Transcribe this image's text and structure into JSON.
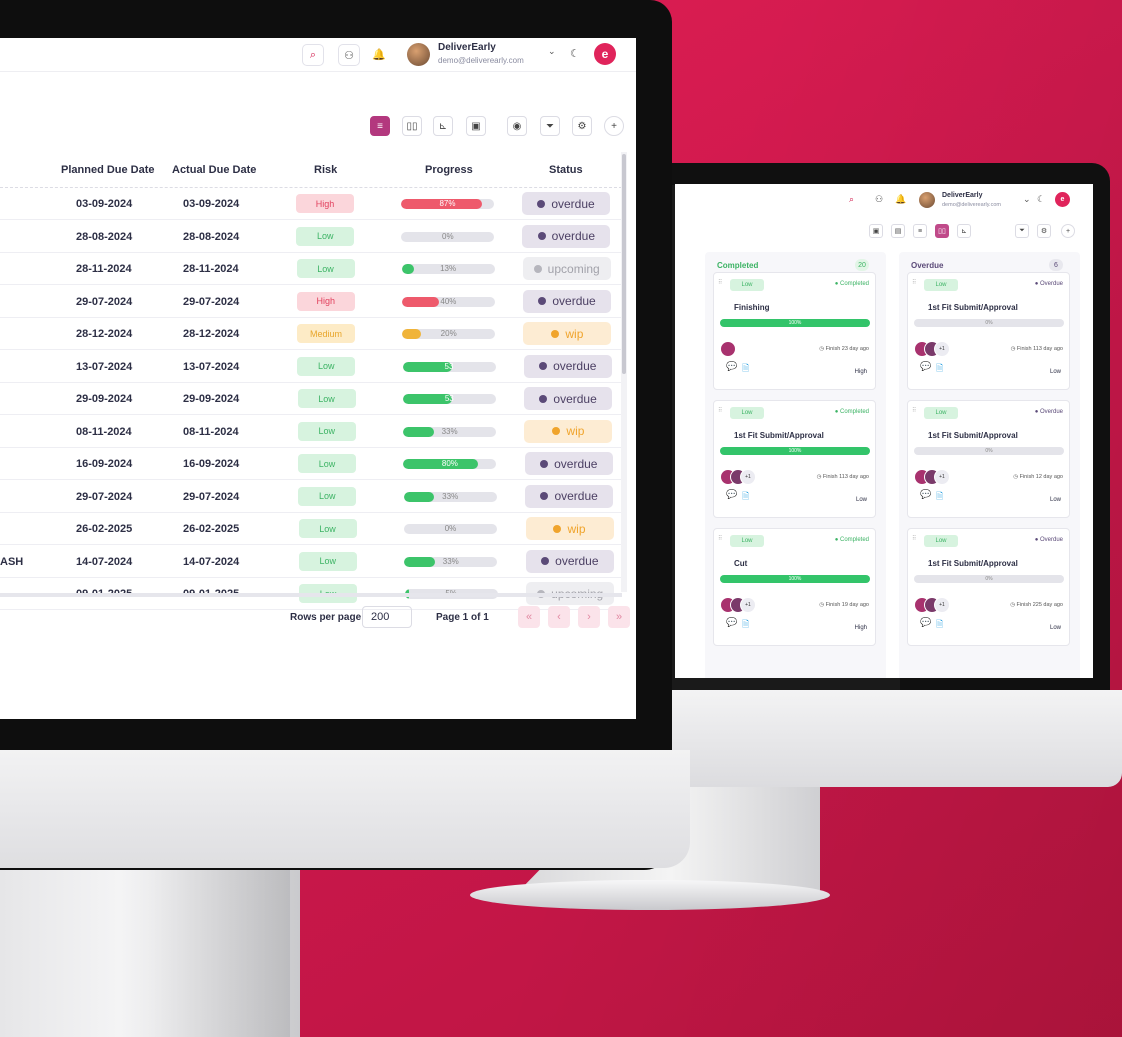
{
  "colors": {
    "brand": "#d11a4c",
    "accent": "#b3387e",
    "high": "#e2415e",
    "low": "#3cb364",
    "medium": "#e8a62c"
  },
  "header": {
    "user_name": "DeliverEarly",
    "user_email": "demo@deliverearly.com",
    "icons": [
      "search-icon",
      "user-add-icon",
      "bell-icon",
      "chevron-down-icon",
      "theme-icon",
      "logo"
    ]
  },
  "toolbar": {
    "icons": [
      "list-view-icon",
      "board-view-icon",
      "gantt-view-icon",
      "archive-icon",
      "eye-icon",
      "filter-icon",
      "settings-icon",
      "add-icon"
    ]
  },
  "table": {
    "columns": {
      "planned": "Planned Due Date",
      "actual": "Actual Due Date",
      "risk": "Risk",
      "progress": "Progress",
      "status": "Status"
    },
    "rows": [
      {
        "name": "",
        "planned": "03-09-2024",
        "actual": "03-09-2024",
        "risk": "High",
        "progress": 87,
        "progress_label": "87%",
        "status": "overdue"
      },
      {
        "name": "",
        "planned": "28-08-2024",
        "actual": "28-08-2024",
        "risk": "Low",
        "progress": 0,
        "progress_label": "0%",
        "status": "overdue"
      },
      {
        "name": "",
        "planned": "28-11-2024",
        "actual": "28-11-2024",
        "risk": "Low",
        "progress": 13,
        "progress_label": "13%",
        "status": "upcoming"
      },
      {
        "name": "",
        "planned": "29-07-2024",
        "actual": "29-07-2024",
        "risk": "High",
        "progress": 40,
        "progress_label": "40%",
        "status": "overdue"
      },
      {
        "name": "",
        "planned": "28-12-2024",
        "actual": "28-12-2024",
        "risk": "Medium",
        "progress": 20,
        "progress_label": "20%",
        "status": "wip"
      },
      {
        "name": "",
        "planned": "13-07-2024",
        "actual": "13-07-2024",
        "risk": "Low",
        "progress": 53,
        "progress_label": "53",
        "status": "overdue"
      },
      {
        "name": "",
        "planned": "29-09-2024",
        "actual": "29-09-2024",
        "risk": "Low",
        "progress": 53,
        "progress_label": "53",
        "status": "overdue"
      },
      {
        "name": "",
        "planned": "08-11-2024",
        "actual": "08-11-2024",
        "risk": "Low",
        "progress": 33,
        "progress_label": "33%",
        "status": "wip"
      },
      {
        "name": "",
        "planned": "16-09-2024",
        "actual": "16-09-2024",
        "risk": "Low",
        "progress": 80,
        "progress_label": "80%",
        "status": "overdue"
      },
      {
        "name": "",
        "planned": "29-07-2024",
        "actual": "29-07-2024",
        "risk": "Low",
        "progress": 33,
        "progress_label": "33%",
        "status": "overdue"
      },
      {
        "name": "",
        "planned": "26-02-2025",
        "actual": "26-02-2025",
        "risk": "Low",
        "progress": 0,
        "progress_label": "0%",
        "status": "wip"
      },
      {
        "name": "ASH",
        "planned": "14-07-2024",
        "actual": "14-07-2024",
        "risk": "Low",
        "progress": 33,
        "progress_label": "33%",
        "status": "overdue"
      },
      {
        "name": "",
        "planned": "09-01-2025",
        "actual": "09-01-2025",
        "risk": "Low",
        "progress": 5,
        "progress_label": "5%",
        "status": "upcoming"
      }
    ]
  },
  "pagination": {
    "rows_per_page_label": "Rows per page",
    "rows_per_page": "200",
    "page_info": "Page 1 of 1",
    "first": "«",
    "prev": "‹",
    "next": "›",
    "last": "»"
  },
  "board": {
    "user_name": "DeliverEarly",
    "user_email": "demo@deliverearly.com",
    "columns": [
      {
        "title": "Completed",
        "count": "20",
        "color": "#3cb364",
        "cards": [
          {
            "tag": "Low",
            "status": "Completed",
            "title": "Finishing",
            "progress_label": "100%",
            "full": true,
            "finish": "Finish 23 day ago",
            "risk": "High",
            "extra": ""
          },
          {
            "tag": "Low",
            "status": "Completed",
            "title": "1st Fit Submit/Approval",
            "progress_label": "100%",
            "full": true,
            "finish": "Finish 113 day ago",
            "risk": "Low",
            "extra": "+1"
          },
          {
            "tag": "Low",
            "status": "Completed",
            "title": "Cut",
            "progress_label": "100%",
            "full": true,
            "finish": "Finish 19 day ago",
            "risk": "High",
            "extra": "+1"
          }
        ]
      },
      {
        "title": "Overdue",
        "count": "6",
        "color": "#5b4a78",
        "cards": [
          {
            "tag": "Low",
            "status": "Overdue",
            "title": "1st Fit Submit/Approval",
            "progress_label": "0%",
            "full": false,
            "finish": "Finish 113 day ago",
            "risk": "Low",
            "extra": "+1"
          },
          {
            "tag": "Low",
            "status": "Overdue",
            "title": "1st Fit Submit/Approval",
            "progress_label": "0%",
            "full": false,
            "finish": "Finish 12 day ago",
            "risk": "Low",
            "extra": "+1"
          },
          {
            "tag": "Low",
            "status": "Overdue",
            "title": "1st Fit Submit/Approval",
            "progress_label": "0%",
            "full": false,
            "finish": "Finish 225 day ago",
            "risk": "Low",
            "extra": "+1"
          }
        ]
      }
    ]
  }
}
